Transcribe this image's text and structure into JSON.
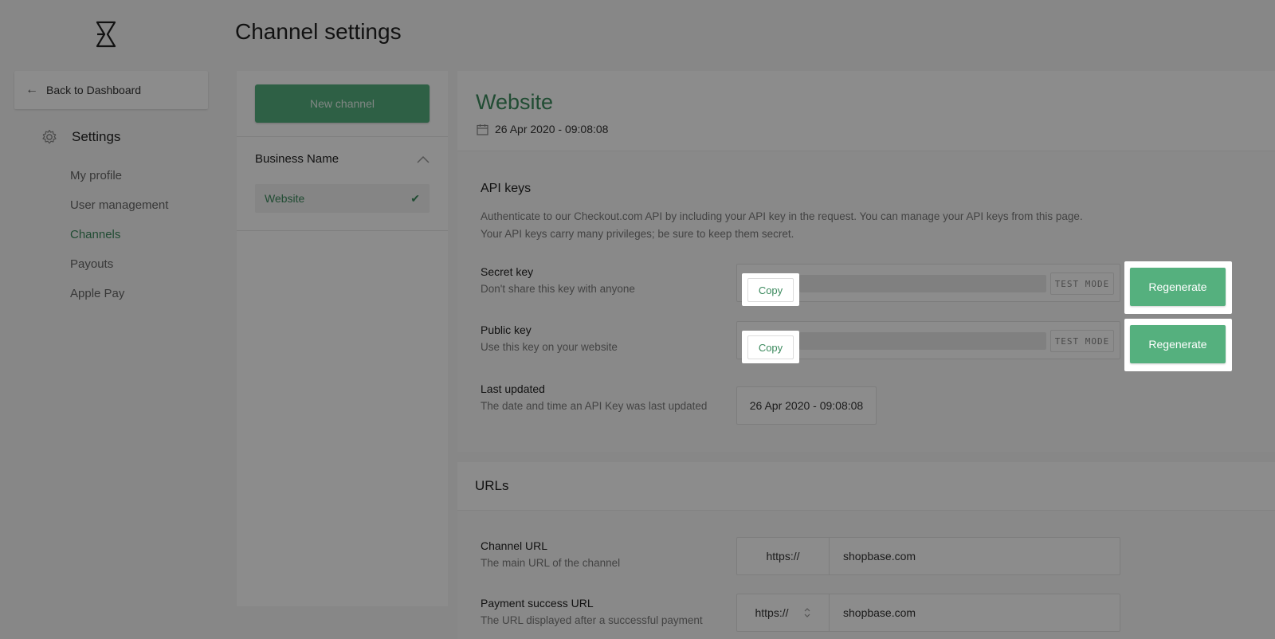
{
  "header": {
    "title": "Channel settings",
    "logo_icon": "hourglass-logo-icon"
  },
  "sidebar": {
    "back_label": "Back to Dashboard",
    "section_title": "Settings",
    "items": [
      {
        "label": "My profile",
        "active": false
      },
      {
        "label": "User management",
        "active": false
      },
      {
        "label": "Channels",
        "active": true
      },
      {
        "label": "Payouts",
        "active": false
      },
      {
        "label": "Apple Pay",
        "active": false
      }
    ]
  },
  "channels": {
    "new_channel_label": "New channel",
    "business_name": "Business Name",
    "selected_channel": "Website"
  },
  "channel": {
    "name": "Website",
    "created": "26 Apr 2020 - 09:08:08"
  },
  "api_keys": {
    "title": "API keys",
    "description_line1": "Authenticate to our Checkout.com API by including your API key in the request. You can manage your API keys from this page.",
    "description_line2": "Your API keys carry many privileges; be sure to keep them secret.",
    "secret": {
      "label": "Secret key",
      "sub": "Don't share this key with anyone",
      "copy": "Copy",
      "mode": "TEST MODE",
      "regenerate": "Regenerate"
    },
    "public": {
      "label": "Public key",
      "sub": "Use this key on your website",
      "copy": "Copy",
      "mode": "TEST MODE",
      "regenerate": "Regenerate"
    },
    "last_updated": {
      "label": "Last updated",
      "sub": "The date and time an API Key was last updated",
      "value": "26 Apr 2020 - 09:08:08"
    }
  },
  "urls": {
    "title": "URLs",
    "channel_url": {
      "label": "Channel URL",
      "sub": "The main URL of the channel",
      "protocol": "https://",
      "value": "shopbase.com"
    },
    "success_url": {
      "label": "Payment success URL",
      "sub": "The URL displayed after a successful payment",
      "protocol": "https://",
      "value": "shopbase.com"
    }
  },
  "colors": {
    "accent": "#3c8a5e",
    "button": "#55b07e",
    "overlay": "rgba(0,0,0,0.45)"
  }
}
